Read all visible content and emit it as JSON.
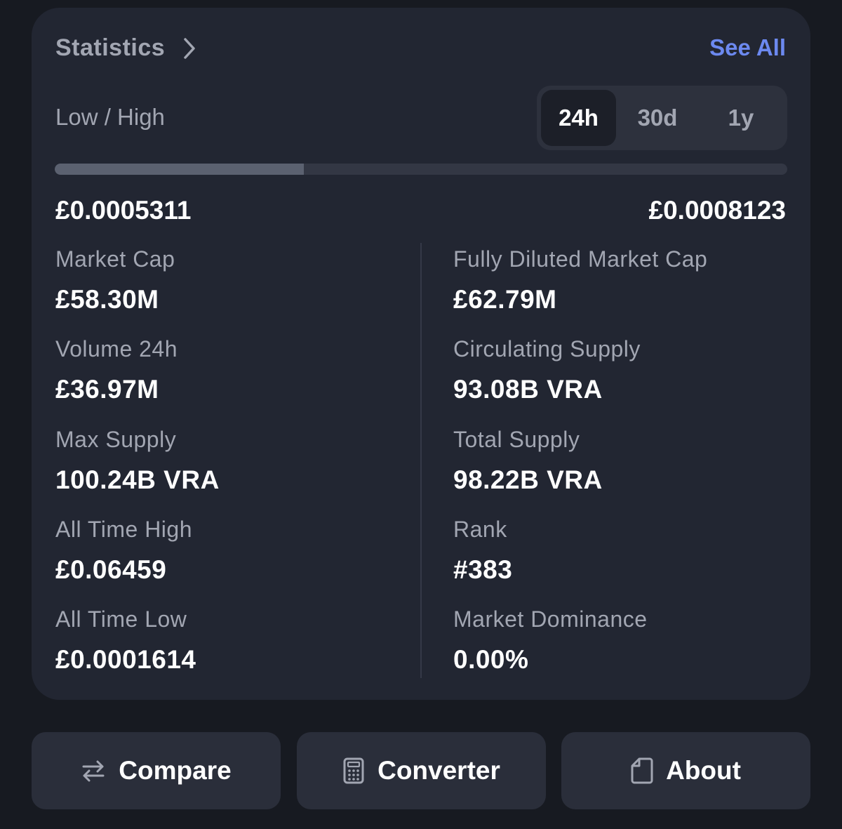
{
  "statistics": {
    "title": "Statistics",
    "see_all": "See All",
    "low_high_label": "Low / High",
    "ranges": [
      "24h",
      "30d",
      "1y"
    ],
    "active_range": "24h",
    "low": "£0.0005311",
    "high": "£0.0008123",
    "range_position": 0.34,
    "left_column": [
      {
        "label": "Market Cap",
        "value": "£58.30M"
      },
      {
        "label": "Volume 24h",
        "value": "£36.97M"
      },
      {
        "label": "Max Supply",
        "value": "100.24B VRA"
      },
      {
        "label": "All Time High",
        "value": "£0.06459"
      },
      {
        "label": "All Time Low",
        "value": "£0.0001614"
      }
    ],
    "right_column": [
      {
        "label": "Fully Diluted Market Cap",
        "value": "£62.79M"
      },
      {
        "label": "Circulating Supply",
        "value": "93.08B VRA"
      },
      {
        "label": "Total Supply",
        "value": "98.22B VRA"
      },
      {
        "label": "Rank",
        "value": "#383"
      },
      {
        "label": "Market Dominance",
        "value": "0.00%"
      }
    ]
  },
  "actions": {
    "compare": "Compare",
    "converter": "Converter",
    "about": "About"
  }
}
